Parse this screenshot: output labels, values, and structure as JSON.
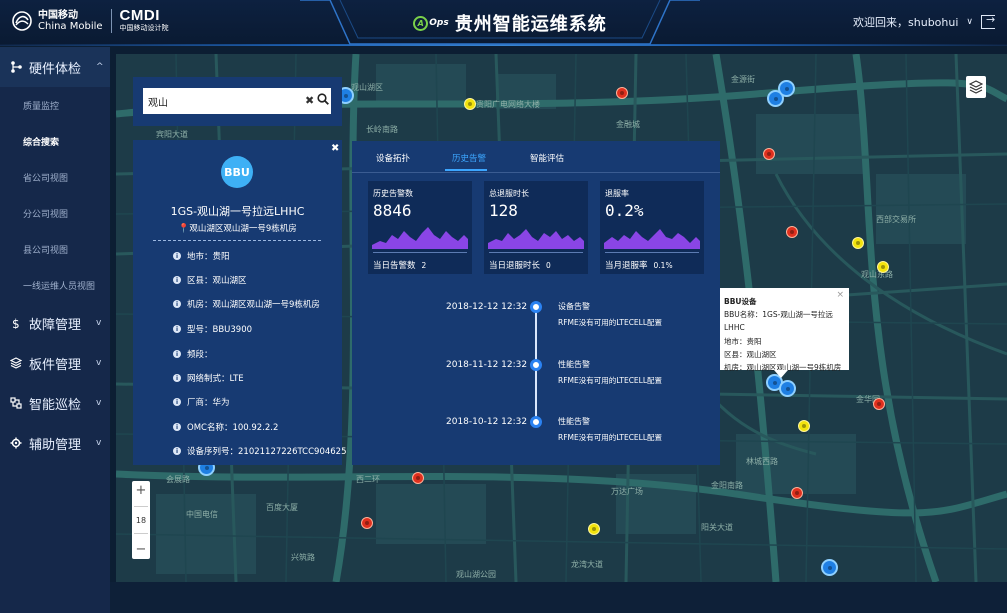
{
  "header": {
    "brand_cn": "中国移动",
    "brand_en": "China Mobile",
    "brand_cmdi": "CMDI",
    "brand_cmdi_sub": "中国移动设计院",
    "aops_label": "Ops",
    "aops_letter": "A",
    "app_title": "贵州智能运维系统",
    "welcome": "欢迎回来，shubohui"
  },
  "sidebar": {
    "groups": [
      {
        "label": "硬件体检",
        "icon": "hardware-icon",
        "open": true
      },
      {
        "label": "故障管理",
        "icon": "fault-icon"
      },
      {
        "label": "板件管理",
        "icon": "board-icon"
      },
      {
        "label": "智能巡检",
        "icon": "inspection-icon"
      },
      {
        "label": "辅助管理",
        "icon": "settings-icon"
      }
    ],
    "subitems": [
      "质量监控",
      "综合搜索",
      "省公司视图",
      "分公司视图",
      "县公司视图",
      "一线运维人员视图"
    ],
    "active_subitem": "综合搜索"
  },
  "search": {
    "value": "观山",
    "clear": "✖"
  },
  "device": {
    "badge": "BBU",
    "name": "1GS-观山湖一号拉远LHHC",
    "location": "观山湖区观山湖一号9栋机房",
    "attrs": [
      "地市：贵阳",
      "区县：观山湖区",
      "机房：观山湖区观山湖一号9栋机房",
      "型号：BBU3900",
      "频段：",
      "网络制式：LTE",
      "厂商：华为",
      "OMC名称：100.92.2.2",
      "设备序列号：21021127226TCC904625"
    ]
  },
  "panel": {
    "tabs": [
      "设备拓扑",
      "历史告警",
      "智能评估"
    ],
    "active_tab": "历史告警",
    "stats": [
      {
        "title": "历史告警数",
        "value": "8846",
        "foot_label": "当日告警数",
        "foot_value": "2"
      },
      {
        "title": "总退服时长",
        "value": "128",
        "foot_label": "当日退服时长",
        "foot_value": "0"
      },
      {
        "title": "退服率",
        "value": "0.2%",
        "foot_label": "当月退服率",
        "foot_value": "0.1%"
      }
    ],
    "timeline": [
      {
        "date": "2018-12-12 12:32",
        "type": "设备告警",
        "desc": "RFME没有可用的LTECELL配置"
      },
      {
        "date": "2018-11-12 12:32",
        "type": "性能告警",
        "desc": "RFME没有可用的LTECELL配置"
      },
      {
        "date": "2018-10-12 12:32",
        "type": "性能告警",
        "desc": "RFME没有可用的LTECELL配置"
      }
    ]
  },
  "popup": {
    "title": "BBU设备",
    "lines": [
      "BBU名称：1GS-观山湖一号拉远LHHC",
      "地市：贵阳",
      "区县：观山湖区",
      "机房：观山湖区观山湖一号9栋机房"
    ],
    "close": "×"
  },
  "map": {
    "zoom_level": "18",
    "zoom_in": "+",
    "zoom_out": "−",
    "labels": [
      "观山湖区",
      "贵阳广电网络大楼",
      "金融城",
      "金华园",
      "中国电信",
      "百度大厦",
      "观山湖公园",
      "龙湾大道",
      "万达广场",
      "金阳南路",
      "西部交易所",
      "林城西路",
      "观山东路",
      "长岭南路",
      "兴筑路",
      "金源街",
      "宾阳大道",
      "阳关大道",
      "会展路",
      "西二环"
    ],
    "colors": {
      "alarm_red": "#e0301e",
      "alarm_yellow": "#f2e30d",
      "site_blue": "#1f7fe3"
    }
  }
}
